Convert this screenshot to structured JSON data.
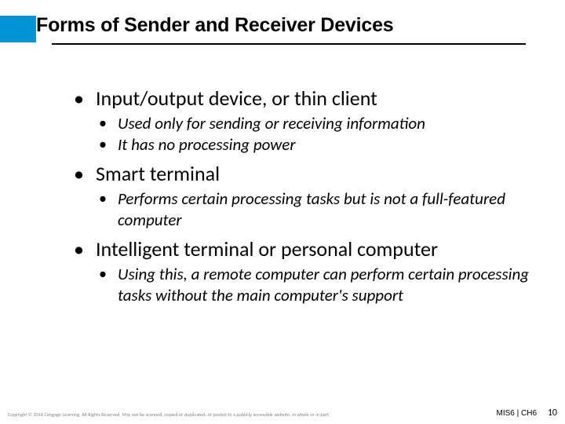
{
  "slide": {
    "title": "Forms of Sender and Receiver Devices",
    "bullets": [
      {
        "text": "Input/output device, or thin client",
        "sub": [
          "Used only for sending or receiving information",
          "It has no processing power"
        ]
      },
      {
        "text": "Smart terminal",
        "sub": [
          "Performs certain processing tasks but is not a full-featured computer"
        ]
      },
      {
        "text": "Intelligent terminal or personal computer",
        "sub": [
          "Using this, a remote computer can perform certain processing tasks without the main computer's support"
        ]
      }
    ]
  },
  "footer": {
    "copyright": "Copyright © 2016 Cengage Learning. All Rights Reserved. May not be scanned, copied or duplicated, or posted to a publicly accessible website, in whole or in part.",
    "label": "MIS6 | CH6",
    "page": "10"
  }
}
